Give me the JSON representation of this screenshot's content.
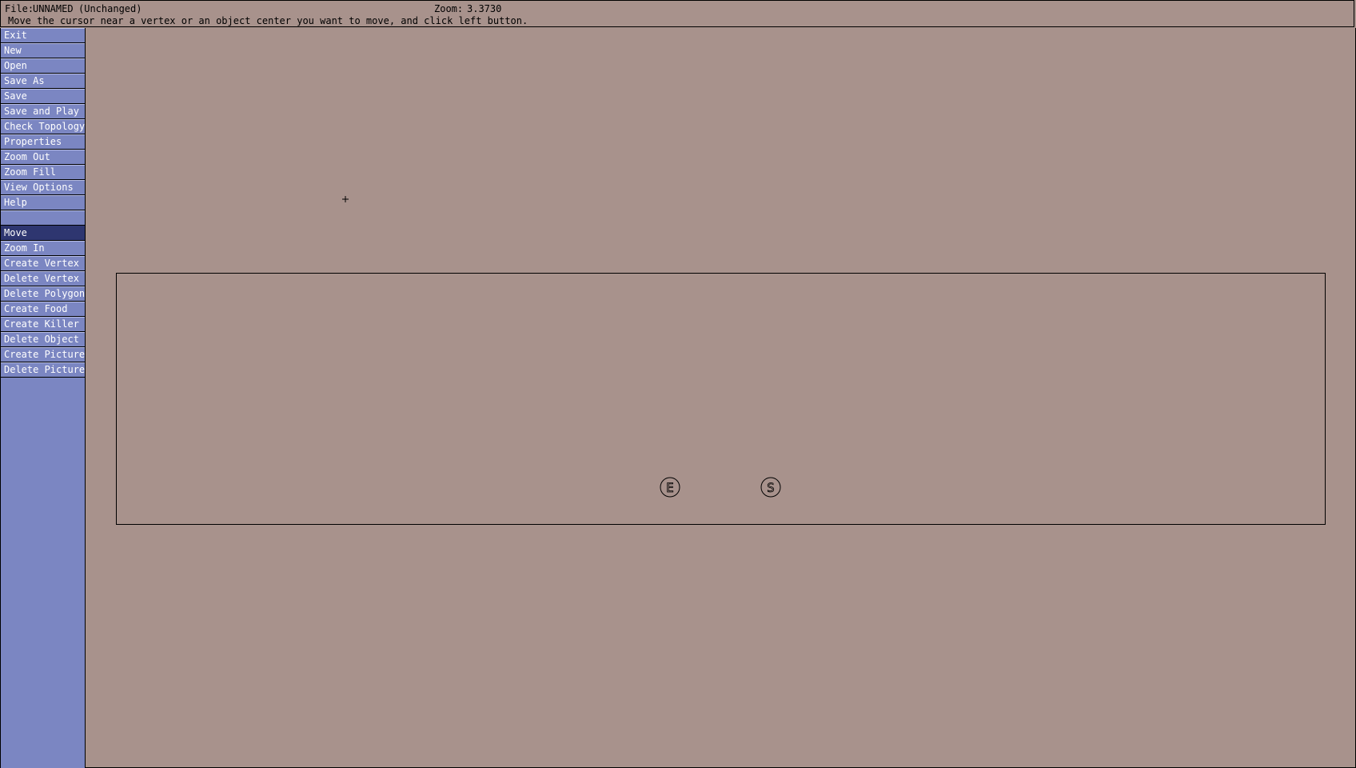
{
  "header": {
    "file_label": "File:",
    "file_name": "UNNAMED",
    "file_state": "(Unchanged)",
    "zoom_label": "Zoom:",
    "zoom_value": "3.3730",
    "status_message": "Move the cursor near a vertex or an object center you want to move, and click left button."
  },
  "sidebar": {
    "commands": [
      {
        "label": "Exit"
      },
      {
        "label": "New"
      },
      {
        "label": "Open"
      },
      {
        "label": "Save As"
      },
      {
        "label": "Save"
      },
      {
        "label": "Save and Play"
      },
      {
        "label": "Check Topology"
      },
      {
        "label": "Properties"
      },
      {
        "label": "Zoom Out"
      },
      {
        "label": "Zoom Fill"
      },
      {
        "label": "View Options"
      },
      {
        "label": "Help"
      }
    ],
    "tools": [
      {
        "label": "Move",
        "selected": true
      },
      {
        "label": "Zoom In"
      },
      {
        "label": "Create Vertex"
      },
      {
        "label": "Delete Vertex"
      },
      {
        "label": "Delete Polygon"
      },
      {
        "label": "Create Food"
      },
      {
        "label": "Create Killer"
      },
      {
        "label": "Delete Object"
      },
      {
        "label": "Create Picture"
      },
      {
        "label": "Delete Picture"
      }
    ]
  },
  "canvas": {
    "objects": [
      {
        "type": "exit",
        "letter": "E"
      },
      {
        "type": "start",
        "letter": "S"
      }
    ]
  },
  "colors": {
    "canvas_bg": "#a8928c",
    "sidebar_bg": "#7b86c2",
    "selected_bg": "#2e3670",
    "menu_text": "#ffffff"
  }
}
